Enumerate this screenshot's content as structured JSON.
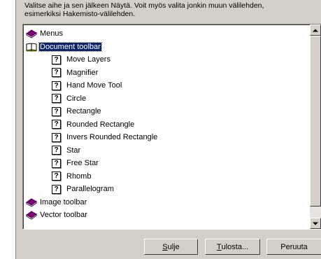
{
  "instructions": {
    "line1": "Valitse aihe ja sen jälkeen Näytä. Voit myös valita jonkin muun välilehden,",
    "line2": "esimerkiksi Hakemisto-välilehden."
  },
  "topics": [
    {
      "label": "Menus",
      "icon": "book-icon",
      "selected": false
    },
    {
      "label": "Document toolbar",
      "icon": "open-book-icon",
      "selected": true
    },
    {
      "label": "Move Layers",
      "icon": "help-topic-icon"
    },
    {
      "label": "Magnifier",
      "icon": "help-topic-icon"
    },
    {
      "label": "Hand Move Tool",
      "icon": "help-topic-icon"
    },
    {
      "label": "Circle",
      "icon": "help-topic-icon"
    },
    {
      "label": "Rectangle",
      "icon": "help-topic-icon"
    },
    {
      "label": "Rounded Rectangle",
      "icon": "help-topic-icon"
    },
    {
      "label": "Invers Rounded Rectangle",
      "icon": "help-topic-icon"
    },
    {
      "label": "Star",
      "icon": "help-topic-icon"
    },
    {
      "label": "Free Star",
      "icon": "help-topic-icon"
    },
    {
      "label": "Rhomb",
      "icon": "help-topic-icon"
    },
    {
      "label": "Parallelogram",
      "icon": "help-topic-icon"
    },
    {
      "label": "Image toolbar",
      "icon": "book-icon",
      "selected": false
    },
    {
      "label": "Vector toolbar",
      "icon": "book-icon",
      "selected": false
    }
  ],
  "topic_icon_glyph": "?",
  "buttons": {
    "close": {
      "mnemonic": "S",
      "rest": "ulje"
    },
    "print": {
      "mnemonic": "T",
      "rest": "ulosta..."
    },
    "cancel": {
      "label": "Peruuta"
    }
  },
  "colors": {
    "selection": "#0a246a",
    "face": "#d4d0c8"
  }
}
